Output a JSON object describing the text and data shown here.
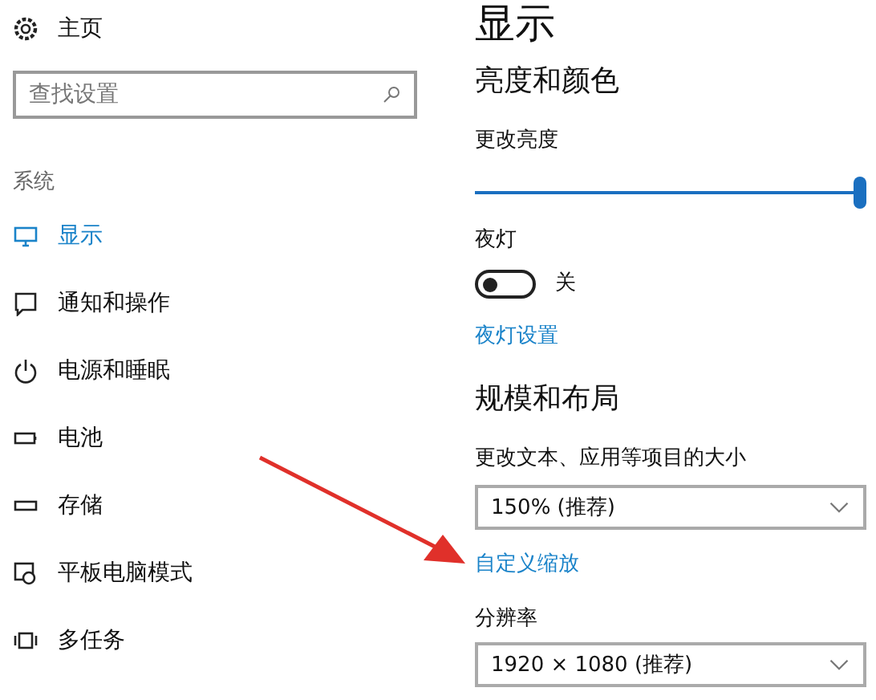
{
  "sidebar": {
    "home": {
      "label": "主页"
    },
    "search": {
      "placeholder": "查找设置"
    },
    "section": "系统",
    "items": [
      {
        "label": "显示",
        "selected": true
      },
      {
        "label": "通知和操作",
        "selected": false
      },
      {
        "label": "电源和睡眠",
        "selected": false
      },
      {
        "label": "电池",
        "selected": false
      },
      {
        "label": "存储",
        "selected": false
      },
      {
        "label": "平板电脑模式",
        "selected": false
      },
      {
        "label": "多任务",
        "selected": false
      }
    ]
  },
  "main": {
    "title": "显示",
    "brightness": {
      "heading": "亮度和颜色",
      "label": "更改亮度",
      "level": 1
    },
    "night_light": {
      "label": "夜灯",
      "on": false,
      "state_text": "关",
      "link": "夜灯设置"
    },
    "scale": {
      "heading": "规模和布局",
      "label": "更改文本、应用等项目的大小",
      "value": "150% (推荐)",
      "link": "自定义缩放"
    },
    "resolution": {
      "label": "分辨率",
      "value": "1920 × 1080 (推荐)"
    }
  }
}
